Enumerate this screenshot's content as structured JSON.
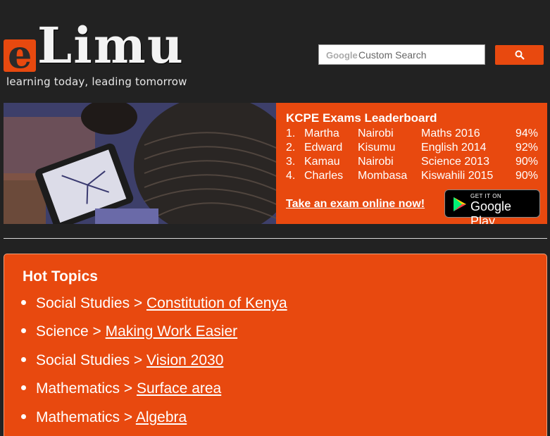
{
  "logo": {
    "letter": "e",
    "name": "Limu",
    "tagline": "learning today, leading tomorrow"
  },
  "search": {
    "brand": "Google",
    "placeholder": "Custom Search",
    "button_icon": "search-icon"
  },
  "leaderboard": {
    "title": "KCPE Exams Leaderboard",
    "rows": [
      {
        "rank": "1.",
        "name": "Martha",
        "town": "Nairobi",
        "exam": "Maths 2016",
        "score": "94%"
      },
      {
        "rank": "2.",
        "name": "Edward",
        "town": "Kisumu",
        "exam": "English 2014",
        "score": "92%"
      },
      {
        "rank": "3.",
        "name": "Kamau",
        "town": "Nairobi",
        "exam": "Science 2013",
        "score": "90%"
      },
      {
        "rank": "4.",
        "name": "Charles",
        "town": "Mombasa",
        "exam": "Kiswahili 2015",
        "score": "90%"
      }
    ],
    "cta_link": "Take an exam online now!",
    "store_badge": {
      "small": "GET IT ON",
      "big": "Google Play",
      "icon": "play-triangle-icon"
    }
  },
  "hot_topics": {
    "title": "Hot Topics",
    "items": [
      {
        "subject": "Social Studies",
        "sep": " > ",
        "link": "Constitution of Kenya"
      },
      {
        "subject": "Science",
        "sep": " > ",
        "link": "Making Work Easier"
      },
      {
        "subject": "Social Studies",
        "sep": " > ",
        "link": "Vision 2030"
      },
      {
        "subject": "Mathematics",
        "sep": " > ",
        "link": "Surface area"
      },
      {
        "subject": "Mathematics",
        "sep": " > ",
        "link": "Algebra"
      }
    ]
  },
  "colors": {
    "background": "#222222",
    "accent": "#e8490f",
    "text": "#ffffff"
  }
}
